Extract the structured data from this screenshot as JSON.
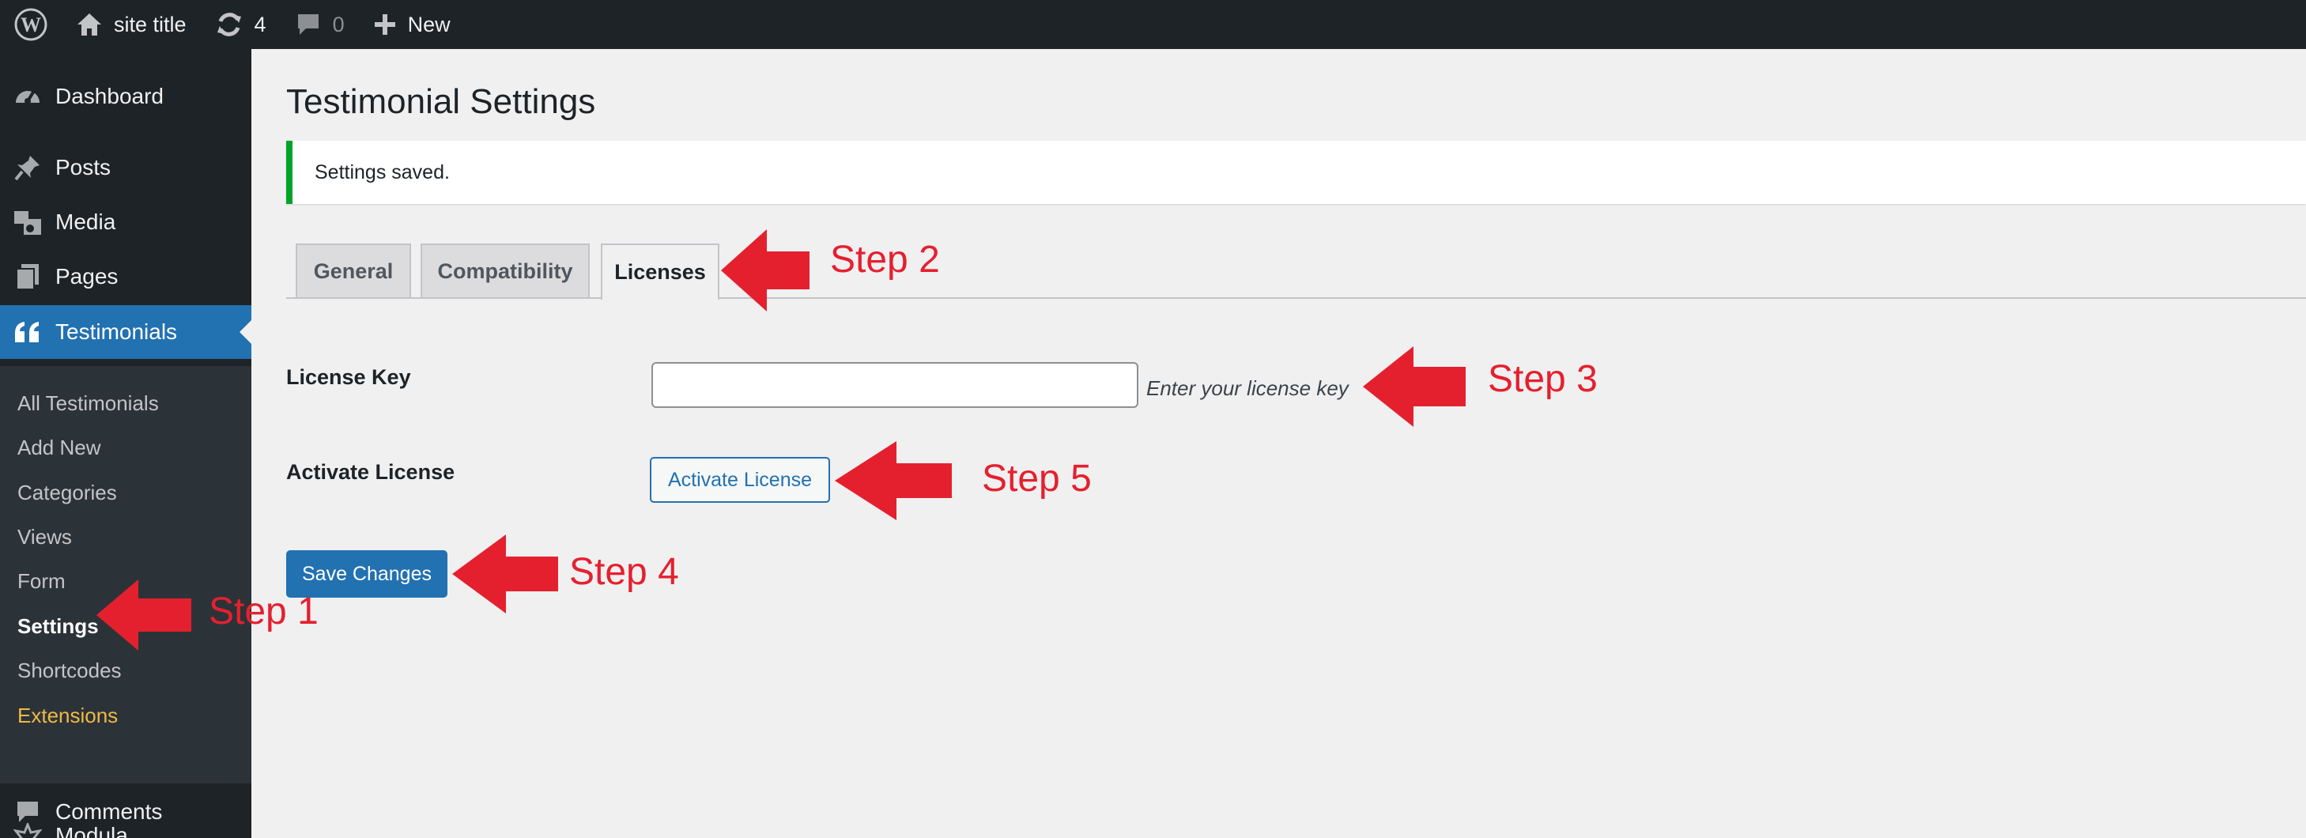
{
  "admin_bar": {
    "site_title": "site title",
    "updates_count": "4",
    "comments_count": "0",
    "new_label": "New"
  },
  "sidebar": {
    "items": [
      {
        "label": "Dashboard",
        "icon": "dashboard-icon"
      },
      {
        "label": "Posts",
        "icon": "pin-icon"
      },
      {
        "label": "Media",
        "icon": "media-icon"
      },
      {
        "label": "Pages",
        "icon": "pages-icon"
      },
      {
        "label": "Testimonials",
        "icon": "quote-icon"
      },
      {
        "label": "Comments",
        "icon": "comment-icon"
      },
      {
        "label": "Modula",
        "icon": "modula-icon"
      }
    ],
    "submenu": [
      {
        "label": "All Testimonials"
      },
      {
        "label": "Add New"
      },
      {
        "label": "Categories"
      },
      {
        "label": "Views"
      },
      {
        "label": "Form"
      },
      {
        "label": "Settings"
      },
      {
        "label": "Shortcodes"
      },
      {
        "label": "Extensions"
      }
    ]
  },
  "page": {
    "title": "Testimonial Settings",
    "notice": "Settings saved.",
    "tabs": [
      {
        "label": "General"
      },
      {
        "label": "Compatibility"
      },
      {
        "label": "Licenses"
      }
    ],
    "license_key_label": "License Key",
    "license_key_value": "",
    "license_key_description": "Enter your license key",
    "activate_label": "Activate License",
    "activate_button": "Activate License",
    "save_button": "Save Changes"
  },
  "annotations": {
    "step1": "Step 1",
    "step2": "Step 2",
    "step3": "Step 3",
    "step4": "Step 4",
    "step5": "Step 5"
  },
  "colors": {
    "admin_dark": "#1d2327",
    "submenu_bg": "#2c3338",
    "accent": "#2271b1",
    "success": "#00a32a",
    "annotation_red": "#e5202e",
    "extensions": "#f0b849"
  }
}
